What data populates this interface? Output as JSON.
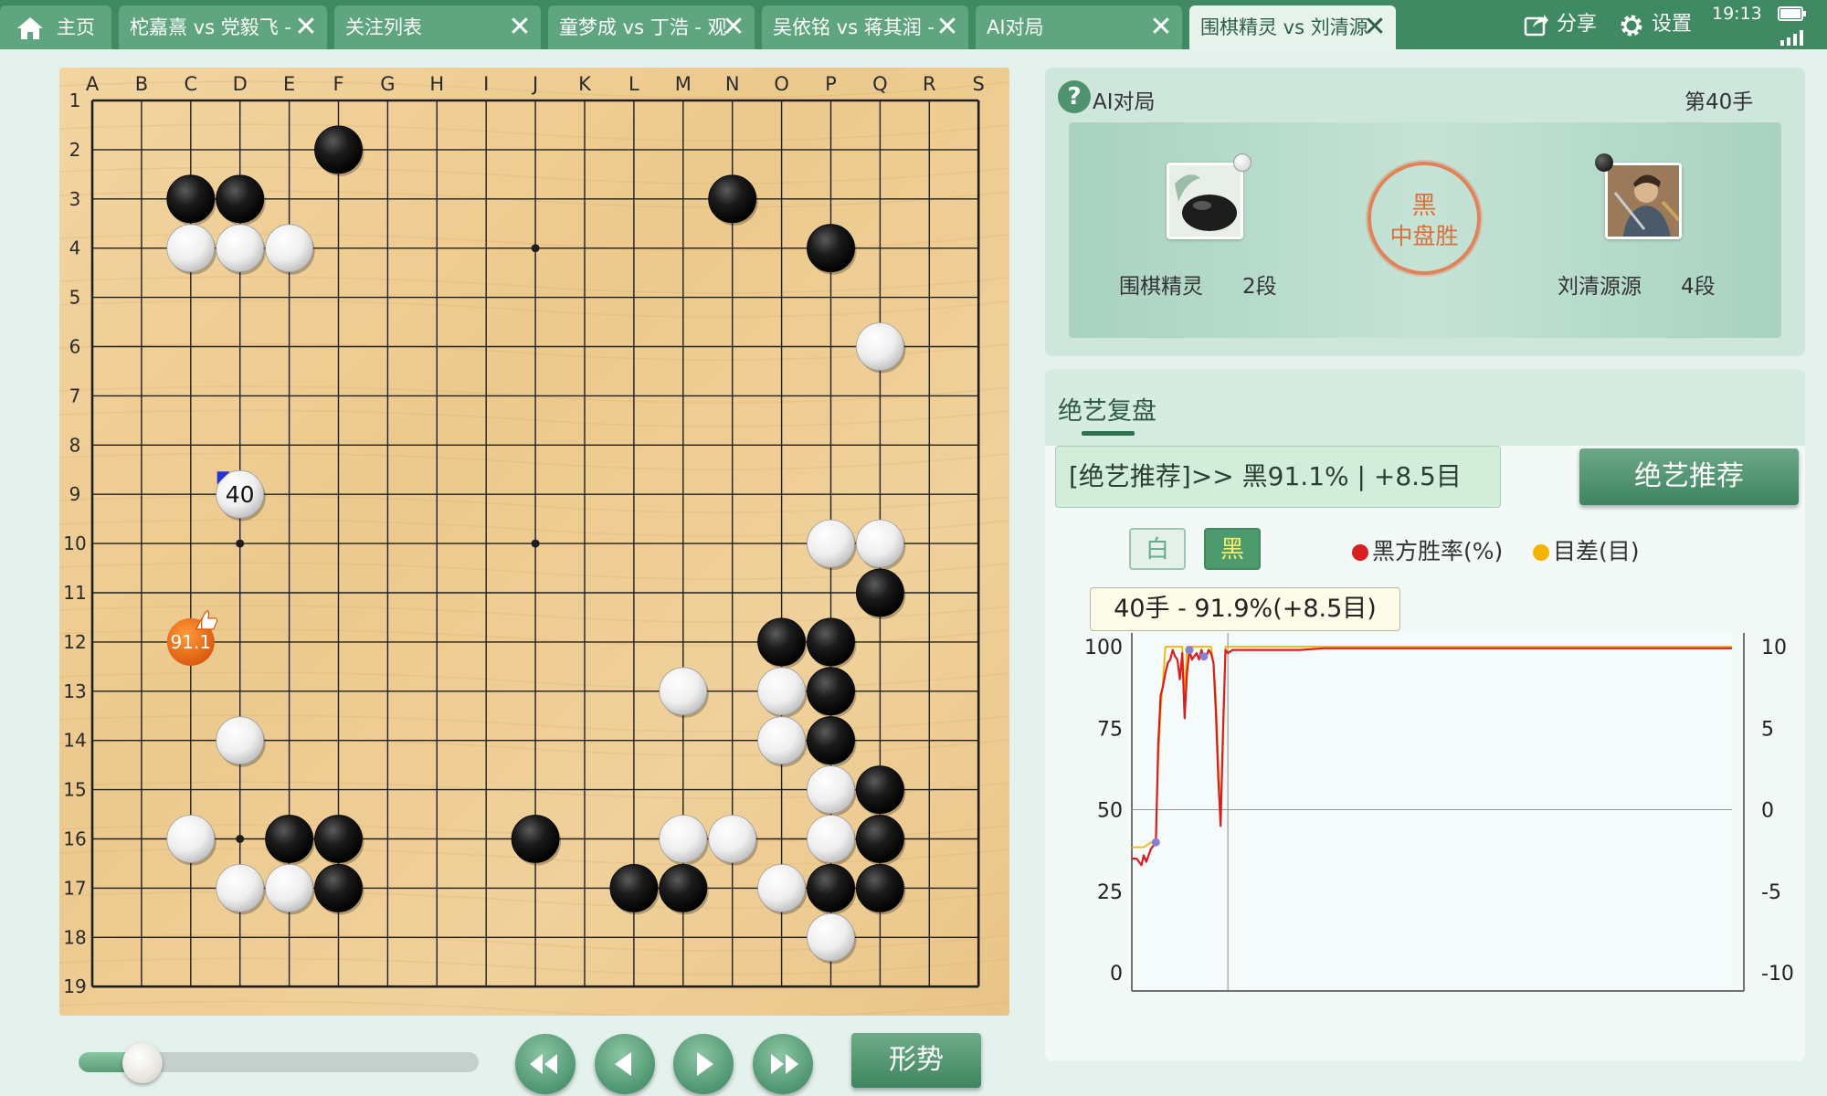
{
  "tabs": [
    {
      "label": "主页",
      "active": false
    },
    {
      "label": "柁嘉熹 vs 党毅飞 - ",
      "active": false
    },
    {
      "label": "关注列表",
      "active": false
    },
    {
      "label": "童梦成 vs 丁浩 - 观",
      "active": false
    },
    {
      "label": "吴依铭 vs 蒋其润 - ",
      "active": false
    },
    {
      "label": "AI对局",
      "active": false
    },
    {
      "label": "围棋精灵 vs 刘清源",
      "active": true
    }
  ],
  "tab_close_glyph": "✕",
  "topbar": {
    "share_label": "分享",
    "settings_label": "设置"
  },
  "status": {
    "time": "19:13"
  },
  "board": {
    "columns": [
      "A",
      "B",
      "C",
      "D",
      "E",
      "F",
      "G",
      "H",
      "I",
      "J",
      "K",
      "L",
      "M",
      "N",
      "O",
      "P",
      "Q",
      "R",
      "S"
    ],
    "rows": [
      "1",
      "2",
      "3",
      "4",
      "5",
      "6",
      "7",
      "8",
      "9",
      "10",
      "11",
      "12",
      "13",
      "14",
      "15",
      "16",
      "17",
      "18",
      "19"
    ],
    "star_points": [
      "D4",
      "J4",
      "P4",
      "D10",
      "J10",
      "P10",
      "D16",
      "J16",
      "P16"
    ],
    "black_stones": [
      "F2",
      "C3",
      "D3",
      "N3",
      "P4",
      "Q11",
      "O12",
      "P12",
      "P13",
      "P14",
      "Q15",
      "Q16",
      "E16",
      "F16",
      "J16",
      "F17",
      "L17",
      "M17",
      "P17",
      "Q17"
    ],
    "white_stones": [
      "C4",
      "D4",
      "E4",
      "Q6",
      "P10",
      "Q10",
      "M13",
      "O13",
      "O14",
      "D14",
      "P15",
      "C16",
      "M16",
      "N16",
      "P16",
      "D17",
      "E17",
      "O17",
      "P18"
    ],
    "last_move": {
      "point": "D9",
      "number": "40",
      "color": "white"
    },
    "suggestion": {
      "point": "C12",
      "label": "91.1"
    }
  },
  "controls": {
    "slider_progress": 0.16,
    "situation_label": "形势"
  },
  "game": {
    "title": "AI对局",
    "move_label": "第40手",
    "white_player": {
      "name": "围棋精灵",
      "rank": "2段"
    },
    "black_player": {
      "name": "刘清源源",
      "rank": "4段"
    },
    "result_color": "黑",
    "result_text": "中盘胜"
  },
  "review": {
    "tab_label": "绝艺复盘",
    "recommend_text": "[绝艺推荐]>> 黑91.1% | +8.5目",
    "recommend_button": "绝艺推荐",
    "toggle_white": "白",
    "toggle_black": "黑",
    "legend_winrate": "黑方胜率(%)",
    "legend_score": "目差(目)",
    "tooltip": "40手 - 91.9%(+8.5目)"
  },
  "colors": {
    "winrate_line": "#d81e1e",
    "score_line": "#f5b400",
    "accent": "#3f8a63"
  },
  "chart_data": {
    "type": "line",
    "title": "",
    "x": [
      0,
      1,
      2,
      3,
      4,
      5,
      6,
      7,
      8,
      9,
      10,
      11,
      12,
      13,
      14,
      15,
      16,
      17,
      18,
      19,
      20,
      21,
      22,
      23,
      24,
      25,
      26,
      27,
      28,
      29,
      30,
      31,
      32,
      33,
      34,
      35,
      36,
      37,
      38,
      39,
      40,
      42,
      44,
      46,
      48,
      50,
      55,
      60,
      70,
      80,
      90,
      100,
      120,
      140,
      160,
      180,
      200,
      220,
      240,
      250
    ],
    "series": [
      {
        "name": "黑方胜率(%)",
        "axis": "left",
        "values": [
          35,
          35,
          35,
          34,
          33,
          36,
          34,
          36,
          38,
          39,
          40,
          70,
          85,
          88,
          92,
          95,
          96,
          99,
          97,
          96,
          90,
          98,
          78,
          92,
          99,
          96,
          97,
          98,
          96,
          99,
          97,
          97,
          99,
          98,
          95,
          80,
          60,
          45,
          75,
          99,
          98,
          99,
          99,
          99,
          99,
          99,
          99,
          99,
          99,
          99.5,
          99.5,
          99.5,
          99.5,
          99.5,
          99.5,
          99.5,
          99.5,
          99.5,
          99.5,
          99.5
        ]
      },
      {
        "name": "目差(目)",
        "axis": "right",
        "values": [
          -2.3,
          -2.3,
          -2.3,
          -2.3,
          -2.3,
          -2.3,
          -2.2,
          -2.1,
          -2,
          -2,
          -2,
          3,
          6,
          8,
          10,
          10,
          10,
          10,
          10,
          10,
          10,
          10,
          7,
          10,
          10,
          10,
          10,
          10,
          10,
          10,
          10,
          10,
          10,
          10,
          9,
          7,
          3,
          -0.5,
          4,
          10,
          10,
          10,
          10,
          10,
          10,
          10,
          10,
          10,
          10,
          10,
          10,
          10,
          10,
          10,
          10,
          10,
          10,
          10,
          10,
          10
        ]
      }
    ],
    "ylim_left": [
      0,
      100
    ],
    "yticks_left": [
      0,
      25,
      50,
      75,
      100
    ],
    "ylim_right": [
      -10,
      10
    ],
    "yticks_right": [
      -10,
      -5,
      0,
      5,
      10
    ],
    "marker_x": 40,
    "reference_y": 50,
    "legend": "top"
  }
}
